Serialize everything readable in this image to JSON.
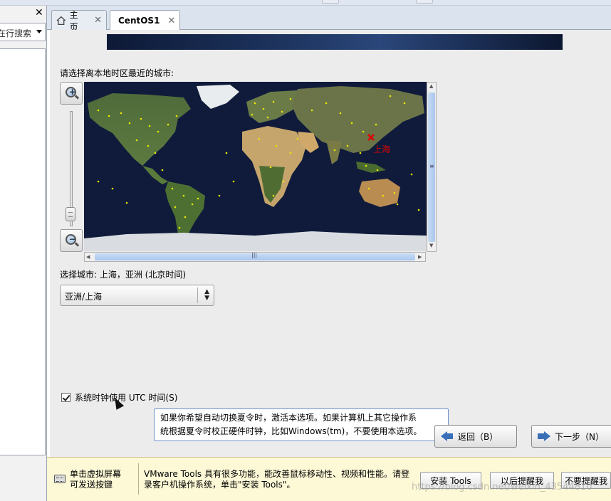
{
  "left_panel": {
    "close_glyph": "✕",
    "search_text": "在行搜索"
  },
  "tabs": [
    {
      "label": "主页",
      "icon": "home-icon",
      "close": "✕"
    },
    {
      "label": "CentOS1",
      "icon": "vm-icon",
      "close": "✕",
      "active": true
    }
  ],
  "installer": {
    "prompt": "请选择离本地时区最近的城市:",
    "map_city_label": "上海",
    "selected_city_text": "选择城市: 上海，亚洲 (北京时间)",
    "timezone_value": "亚洲/上海",
    "utc_checkbox_label": "系统时钟使用 UTC 时间(S)",
    "utc_checked": true,
    "tooltip_line1": "如果你希望自动切换夏令时，激活本选项。如果计算机上其它操作系",
    "tooltip_line2": "统根据夏令时校正硬件时钟，比如Windows(tm)，不要使用本选项。",
    "back_button": "返回（B）",
    "next_button": "下一步（N）",
    "zoom_in": "+",
    "zoom_out": "−"
  },
  "tools_bar": {
    "hint_line1": "单击虚拟屏幕",
    "hint_line2": "可发送按键",
    "message": "VMware Tools 具有很多功能，能改善鼠标移动性、视频和性能。请登录客户机操作系统，单击\"安装 Tools\"。",
    "install_button": "安装 Tools",
    "remind_later_button": "以后提醒我",
    "never_remind_button": "不要提醒我",
    "watermark": "https://blog.csdn.net/weixin_43544810"
  },
  "colors": {
    "city_marker": "#e00000",
    "city_dot": "#e8e800",
    "ocean": "#0f1a38"
  }
}
